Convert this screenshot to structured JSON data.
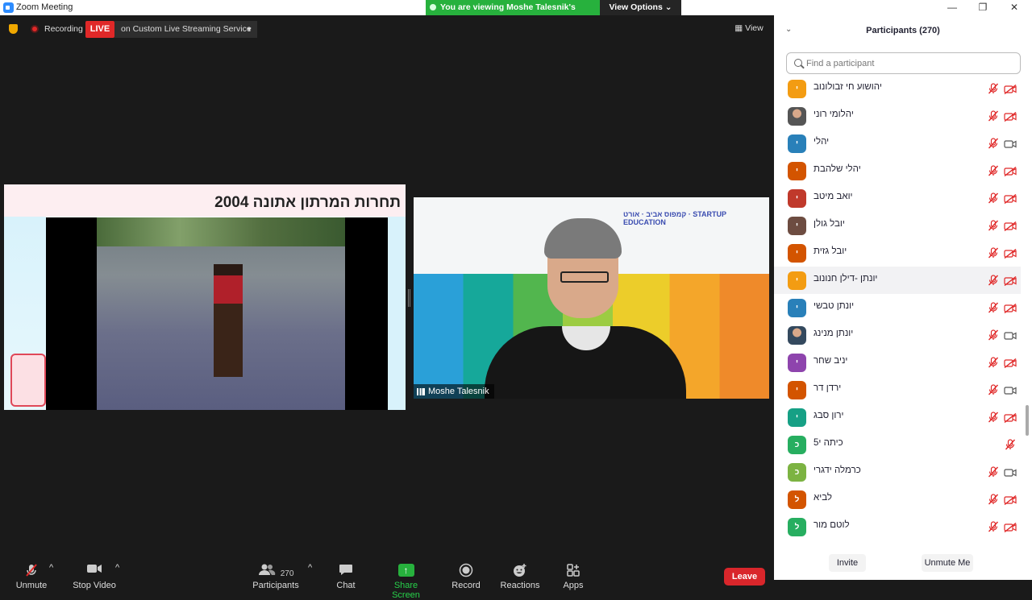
{
  "window": {
    "title": "Zoom Meeting",
    "minimize": "—",
    "maximize": "❐",
    "close": "✕"
  },
  "banner": {
    "viewing_text": "You are viewing Moshe Talesnik's screen",
    "view_options_label": "View Options ⌄"
  },
  "meeting_top": {
    "recording_label": "Recording",
    "live_label": "LIVE",
    "stream_label": "on Custom Live Streaming Service",
    "view_label": "View"
  },
  "slide": {
    "title": "תחרות המרתון אתונה 2004"
  },
  "camera": {
    "participant_name": "Moshe Talesnik",
    "logos_text": "קמפוס אביב · אורט · STARTUP EDUCATION"
  },
  "toolbar": {
    "unmute": "Unmute",
    "stop_video": "Stop Video",
    "participants": "Participants",
    "participants_count": "270",
    "chat": "Chat",
    "share_screen": "Share Screen",
    "record": "Record",
    "reactions": "Reactions",
    "apps": "Apps",
    "leave": "Leave"
  },
  "participants_panel": {
    "title": "Participants (270)",
    "search_placeholder": "Find a participant",
    "invite_label": "Invite",
    "unmute_me_label": "Unmute Me",
    "participants": [
      {
        "name": "יהושוע חי זבולונוב",
        "initial": "י",
        "color": "#f39c12",
        "mic_off": true,
        "cam_off": true,
        "photo": false
      },
      {
        "name": "יהלומי רוני",
        "initial": "",
        "color": "#555555",
        "mic_off": true,
        "cam_off": true,
        "photo": true
      },
      {
        "name": "יהלי",
        "initial": "י",
        "color": "#2980b9",
        "mic_off": true,
        "cam_off": false,
        "photo": false
      },
      {
        "name": "יהלי שלהבת",
        "initial": "י",
        "color": "#d35400",
        "mic_off": true,
        "cam_off": true,
        "photo": false
      },
      {
        "name": "יואב מיטב",
        "initial": "י",
        "color": "#c0392b",
        "mic_off": true,
        "cam_off": true,
        "photo": false
      },
      {
        "name": "יובל גולן",
        "initial": "י",
        "color": "#6d4c41",
        "mic_off": true,
        "cam_off": true,
        "photo": false
      },
      {
        "name": "יובל גזית",
        "initial": "י",
        "color": "#d35400",
        "mic_off": true,
        "cam_off": true,
        "photo": false
      },
      {
        "name": "יונתן -דילן חנונוב",
        "initial": "י",
        "color": "#f39c12",
        "mic_off": true,
        "cam_off": true,
        "photo": false
      },
      {
        "name": "יונתן טבשי",
        "initial": "י",
        "color": "#2980b9",
        "mic_off": true,
        "cam_off": true,
        "photo": false
      },
      {
        "name": "יונתן מנינג",
        "initial": "",
        "color": "#34495e",
        "mic_off": true,
        "cam_off": false,
        "photo": true
      },
      {
        "name": "יניב שחר",
        "initial": "י",
        "color": "#8e44ad",
        "mic_off": true,
        "cam_off": true,
        "photo": false
      },
      {
        "name": "ירדן דר",
        "initial": "י",
        "color": "#d35400",
        "mic_off": true,
        "cam_off": false,
        "photo": false
      },
      {
        "name": "ירון סבג",
        "initial": "י",
        "color": "#16a085",
        "mic_off": true,
        "cam_off": true,
        "photo": false
      },
      {
        "name": "כיתה י5",
        "initial": "כ",
        "color": "#27ae60",
        "mic_off": true,
        "cam_off": null,
        "photo": false
      },
      {
        "name": "כרמלה ידגרי",
        "initial": "כ",
        "color": "#7cb342",
        "mic_off": true,
        "cam_off": false,
        "photo": false
      },
      {
        "name": "לביא",
        "initial": "ל",
        "color": "#d35400",
        "mic_off": true,
        "cam_off": true,
        "photo": false
      },
      {
        "name": "לוטם מור",
        "initial": "ל",
        "color": "#27ae60",
        "mic_off": true,
        "cam_off": true,
        "photo": false
      }
    ]
  },
  "colors": {
    "live_red": "#e02828",
    "share_green": "#27b13d",
    "leave_red": "#d9262b",
    "mic_off_red": "#e02828"
  }
}
